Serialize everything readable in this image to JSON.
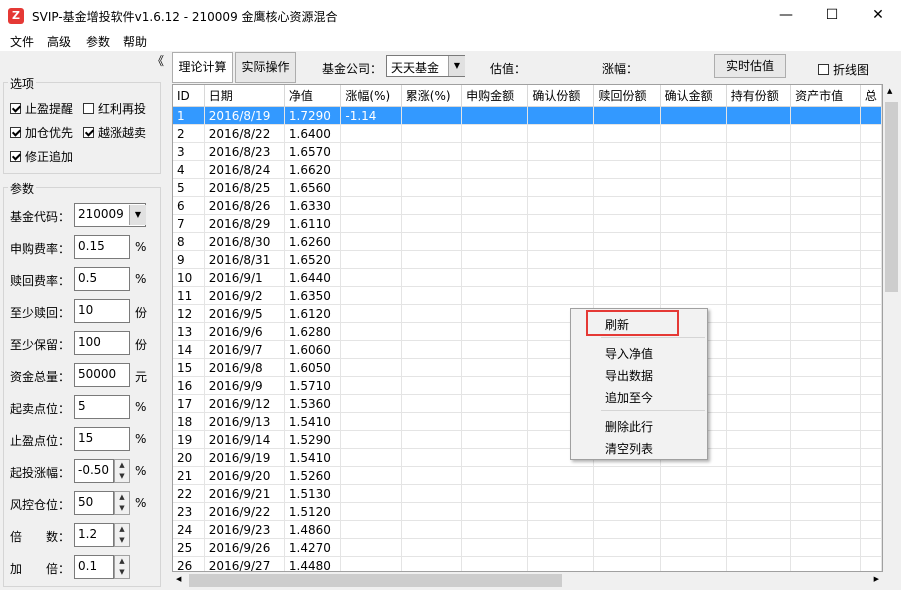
{
  "window": {
    "title": "SVIP-基金增投软件v1.6.12 - 210009 金鹰核心资源混合",
    "app_icon": "Z",
    "minimize": "—",
    "maximize": "☐",
    "close": "✕"
  },
  "menu": [
    "文件",
    "高级",
    "参数",
    "帮助"
  ],
  "collapse_glyph": "《",
  "options": {
    "title": "选项",
    "items": [
      {
        "label": "止盈提醒",
        "checked": true
      },
      {
        "label": "红利再投",
        "checked": false
      },
      {
        "label": "加仓优先",
        "checked": true
      },
      {
        "label": "越涨越卖",
        "checked": true
      },
      {
        "label": "修正追加",
        "checked": true
      }
    ]
  },
  "params": {
    "title": "参数",
    "fields": [
      {
        "label": "基金代码：",
        "value": "210009",
        "unit": ""
      },
      {
        "label": "申购费率：",
        "value": "0.15",
        "unit": "%"
      },
      {
        "label": "赎回费率：",
        "value": "0.5",
        "unit": "%"
      },
      {
        "label": "至少赎回：",
        "value": "10",
        "unit": "份"
      },
      {
        "label": "至少保留：",
        "value": "100",
        "unit": "份"
      },
      {
        "label": "资金总量：",
        "value": "50000",
        "unit": "元"
      },
      {
        "label": "起卖点位：",
        "value": "5",
        "unit": "%"
      },
      {
        "label": "止盈点位：",
        "value": "15",
        "unit": "%"
      },
      {
        "label": "起投涨幅：",
        "value": "-0.50",
        "unit": "%"
      },
      {
        "label": "风控仓位：",
        "value": "50",
        "unit": "%"
      },
      {
        "label": "倍　　数：",
        "value": "1.2",
        "unit": ""
      },
      {
        "label": "加　　倍：",
        "value": "0.1",
        "unit": ""
      }
    ]
  },
  "toolbar": {
    "tab_theory": "理论计算",
    "tab_actual": "实际操作",
    "company_label": "基金公司：",
    "company_value": "天天基金",
    "estimate_label": "估值：",
    "change_label": "涨幅：",
    "realtime_button": "实时估值",
    "chart_label": "折线图",
    "chart_checked": false
  },
  "table": {
    "columns": [
      "ID",
      "日期",
      "净值",
      "涨幅(%)",
      "累涨(%)",
      "申购金额",
      "确认份额",
      "赎回份额",
      "确认金额",
      "持有份额",
      "资产市值",
      "总"
    ],
    "rows": [
      [
        "1",
        "2016/8/19",
        "1.7290",
        "-1.14"
      ],
      [
        "2",
        "2016/8/22",
        "1.6400",
        ""
      ],
      [
        "3",
        "2016/8/23",
        "1.6570",
        ""
      ],
      [
        "4",
        "2016/8/24",
        "1.6620",
        ""
      ],
      [
        "5",
        "2016/8/25",
        "1.6560",
        ""
      ],
      [
        "6",
        "2016/8/26",
        "1.6330",
        ""
      ],
      [
        "7",
        "2016/8/29",
        "1.6110",
        ""
      ],
      [
        "8",
        "2016/8/30",
        "1.6260",
        ""
      ],
      [
        "9",
        "2016/8/31",
        "1.6520",
        ""
      ],
      [
        "10",
        "2016/9/1",
        "1.6440",
        ""
      ],
      [
        "11",
        "2016/9/2",
        "1.6350",
        ""
      ],
      [
        "12",
        "2016/9/5",
        "1.6120",
        ""
      ],
      [
        "13",
        "2016/9/6",
        "1.6280",
        ""
      ],
      [
        "14",
        "2016/9/7",
        "1.6060",
        ""
      ],
      [
        "15",
        "2016/9/8",
        "1.6050",
        ""
      ],
      [
        "16",
        "2016/9/9",
        "1.5710",
        ""
      ],
      [
        "17",
        "2016/9/12",
        "1.5360",
        ""
      ],
      [
        "18",
        "2016/9/13",
        "1.5410",
        ""
      ],
      [
        "19",
        "2016/9/14",
        "1.5290",
        ""
      ],
      [
        "20",
        "2016/9/19",
        "1.5410",
        ""
      ],
      [
        "21",
        "2016/9/20",
        "1.5260",
        ""
      ],
      [
        "22",
        "2016/9/21",
        "1.5130",
        ""
      ],
      [
        "23",
        "2016/9/22",
        "1.5120",
        ""
      ],
      [
        "24",
        "2016/9/23",
        "1.4860",
        ""
      ],
      [
        "25",
        "2016/9/26",
        "1.4270",
        ""
      ],
      [
        "26",
        "2016/9/27",
        "1.4480",
        ""
      ]
    ],
    "selected_row": 0
  },
  "context_menu": {
    "items": [
      "刷新",
      "导入净值",
      "导出数据",
      "追加至今",
      "删除此行",
      "清空列表"
    ],
    "highlight_color": "#e53935"
  },
  "colors": {
    "selection": "#3399ff",
    "highlight": "#e53935"
  }
}
